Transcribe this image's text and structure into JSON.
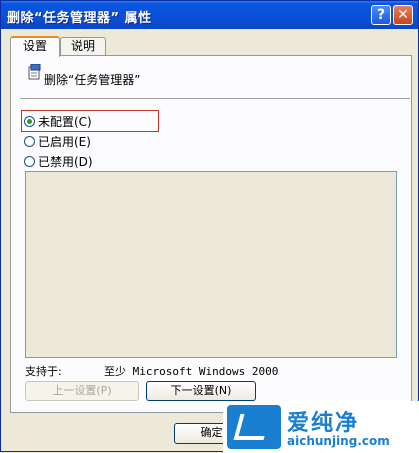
{
  "window": {
    "title": "删除“任务管理器” 属性"
  },
  "title_buttons": {
    "help": "?",
    "close": "✕"
  },
  "tabs": [
    {
      "label": "设置",
      "active": true
    },
    {
      "label": "说明",
      "active": false
    }
  ],
  "policy": {
    "name": "删除“任务管理器”",
    "icon": "policy-icon"
  },
  "options": [
    {
      "label": "未配置(C)",
      "checked": true
    },
    {
      "label": "已启用(E)",
      "checked": false
    },
    {
      "label": "已禁用(D)",
      "checked": false
    }
  ],
  "supported": {
    "label": "支持于:",
    "value": "至少 Microsoft Windows 2000"
  },
  "buttons": {
    "prev": "上一设置(P)",
    "next": "下一设置(N)",
    "ok": "确定"
  },
  "watermark": {
    "title": "爱纯净",
    "url": "aichunjing.com"
  },
  "colors": {
    "titlebar": "#0a55de",
    "highlight": "#c0392b",
    "watermark": "#1a7fd0"
  }
}
